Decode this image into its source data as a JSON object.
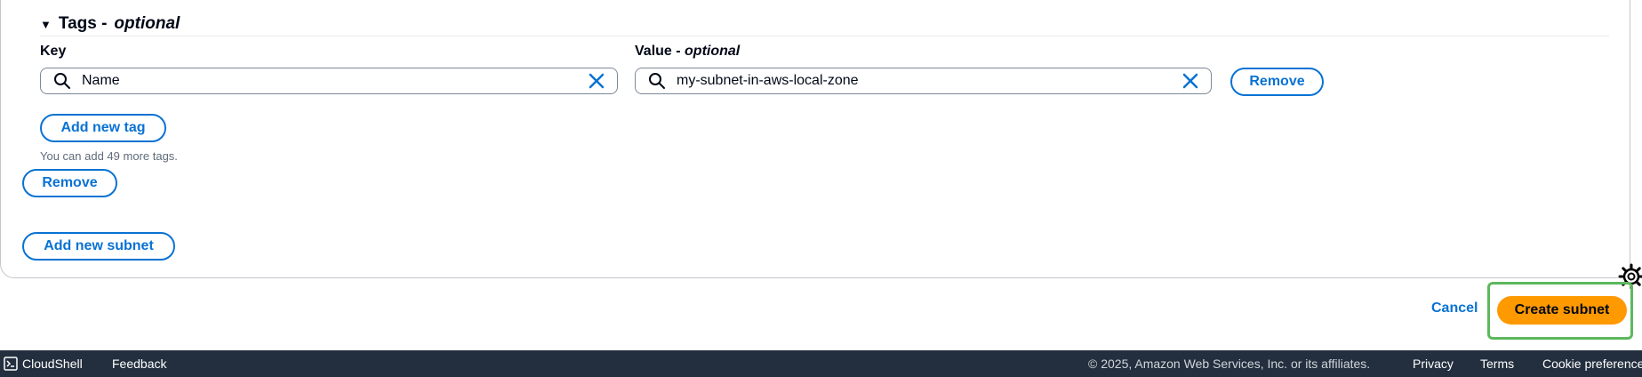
{
  "tags": {
    "header": "Tags -",
    "header_optional": "optional",
    "key_label": "Key",
    "value_label": "Value -",
    "value_optional": "optional",
    "key_value": "Name",
    "value_value": "my-subnet-in-aws-local-zone",
    "remove_tag_label": "Remove",
    "add_tag_label": "Add new tag",
    "hint": "You can add 49 more tags."
  },
  "subnet": {
    "remove_label": "Remove",
    "add_subnet_label": "Add new subnet"
  },
  "actions": {
    "cancel_label": "Cancel",
    "create_label": "Create subnet"
  },
  "footer": {
    "cloudshell": "CloudShell",
    "feedback": "Feedback",
    "copyright": "© 2025, Amazon Web Services, Inc. or its affiliates.",
    "privacy": "Privacy",
    "terms": "Terms",
    "cookies": "Cookie preferences"
  },
  "colors": {
    "primary": "#ff9900",
    "link": "#0972d3",
    "footer_bg": "#232f3e",
    "highlight": "#5cb85c"
  }
}
